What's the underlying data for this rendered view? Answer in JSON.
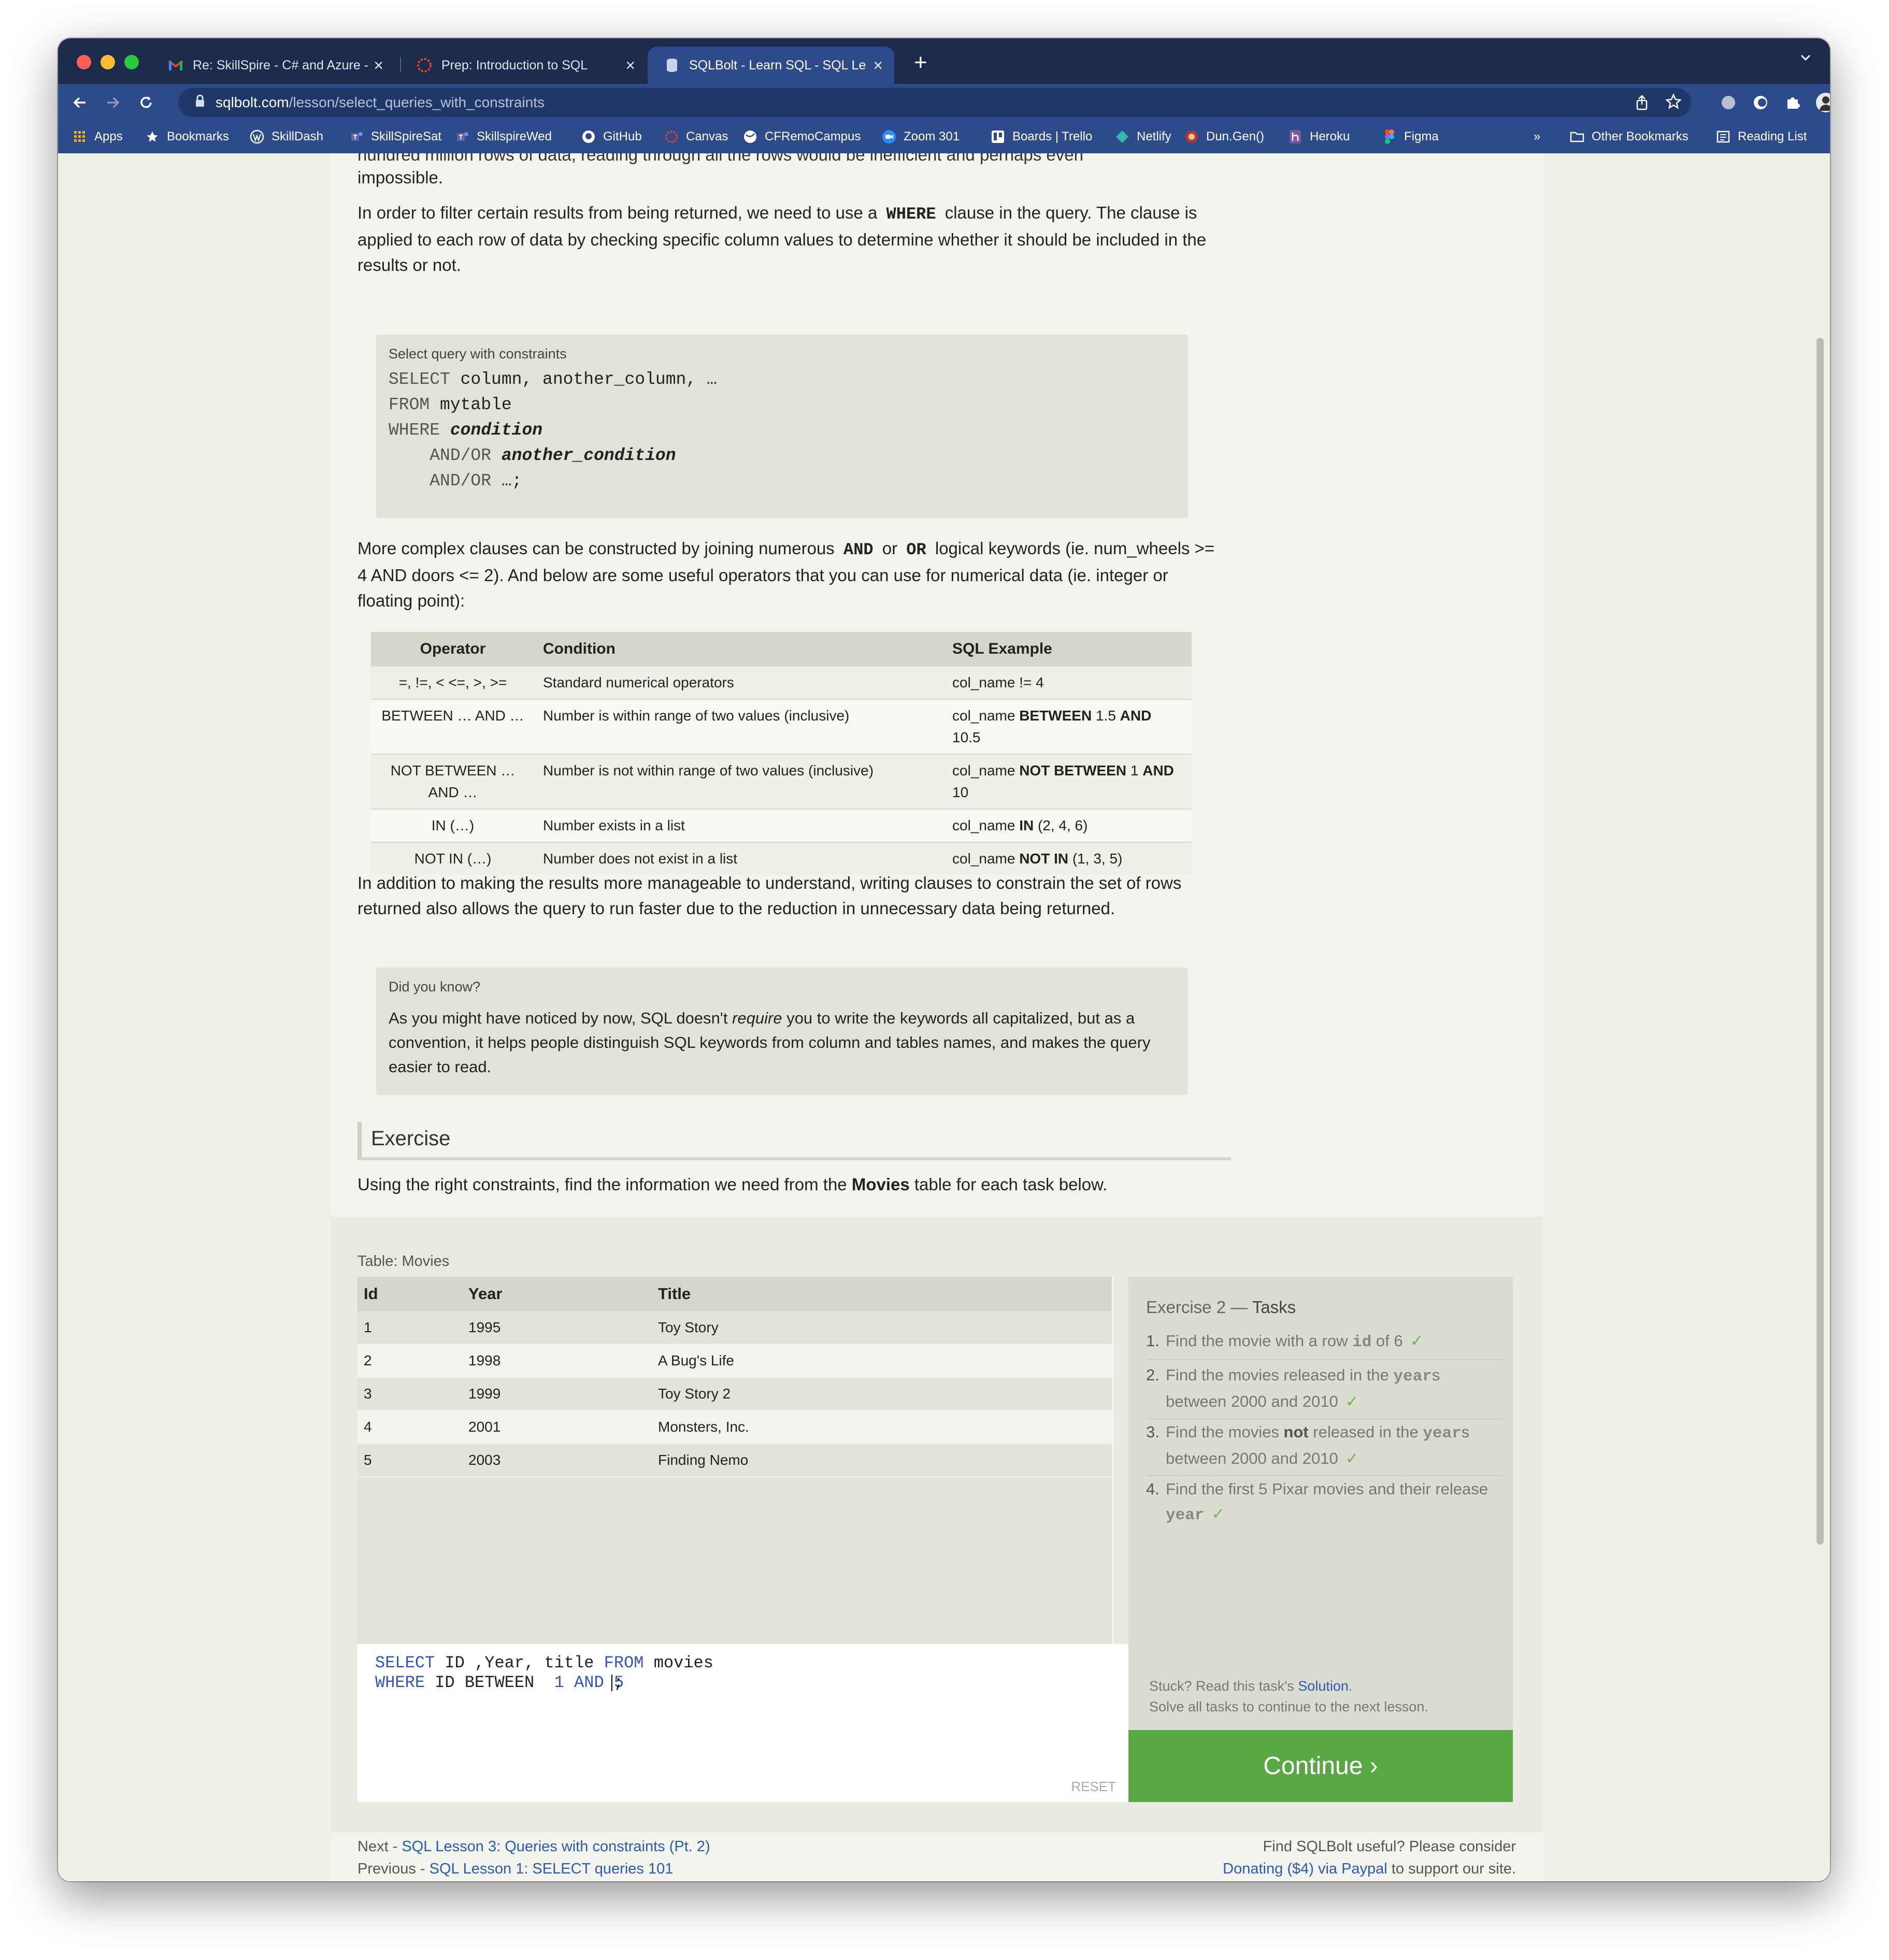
{
  "browser": {
    "tabs": [
      {
        "label": "Re: SkillSpire - C# and Azure -",
        "icon": "gmail-icon",
        "active": false
      },
      {
        "label": "Prep: Introduction to SQL",
        "icon": "canvas-icon",
        "active": false
      },
      {
        "label": "SQLBolt - Learn SQL - SQL Les",
        "icon": "sqlbolt-icon",
        "active": true
      }
    ],
    "new_tab_glyph": "+",
    "address": {
      "host": "sqlbolt.com",
      "path": "/lesson/select_queries_with_constraints"
    },
    "bookmarks": [
      {
        "label": "Apps",
        "icon": "apps-grid-icon"
      },
      {
        "label": "Bookmarks",
        "icon": "star-icon"
      },
      {
        "label": "SkillDash",
        "icon": "wordpress-icon"
      },
      {
        "label": "SkillSpireSat",
        "icon": "teams-icon"
      },
      {
        "label": "SkillspireWed",
        "icon": "teams-icon"
      },
      {
        "label": "GitHub",
        "icon": "github-icon"
      },
      {
        "label": "Canvas",
        "icon": "canvas-icon"
      },
      {
        "label": "CFRemoCampus",
        "icon": "globe-icon"
      },
      {
        "label": "Zoom 301",
        "icon": "zoom-icon"
      },
      {
        "label": "Boards | Trello",
        "icon": "trello-icon"
      },
      {
        "label": "Netlify",
        "icon": "netlify-icon"
      },
      {
        "label": "Dun.Gen()",
        "icon": "dungen-icon"
      },
      {
        "label": "Heroku",
        "icon": "heroku-icon"
      },
      {
        "label": "Figma",
        "icon": "figma-icon"
      }
    ],
    "more_glyph": "»",
    "other_bookmarks": "Other Bookmarks",
    "reading_list": "Reading List"
  },
  "lesson": {
    "cut_top_text": "hundred million rows of data, reading through all the rows would be inefficient and perhaps even",
    "impossible": "impossible.",
    "p1": [
      "In order to filter certain results from being returned, we need to use a",
      "WHERE",
      "clause in the query. The clause is applied to each row of data by checking specific column values to determine whether it should be included in the results or not."
    ],
    "code_caption": "Select query with constraints",
    "code_lines": [
      {
        "parts": [
          [
            "k",
            "SELECT"
          ],
          [
            "n",
            " column, another_column, …"
          ]
        ]
      },
      {
        "parts": [
          [
            "k",
            "FROM"
          ],
          [
            "n",
            " mytable"
          ]
        ]
      },
      {
        "parts": [
          [
            "k",
            "WHERE"
          ],
          [
            "n",
            " "
          ],
          [
            "b",
            "condition"
          ]
        ]
      },
      {
        "parts": [
          [
            "n",
            "    "
          ],
          [
            "k",
            "AND/OR"
          ],
          [
            "n",
            " "
          ],
          [
            "b",
            "another_condition"
          ]
        ]
      },
      {
        "parts": [
          [
            "n",
            "    "
          ],
          [
            "k",
            "AND/OR"
          ],
          [
            "n",
            " …;"
          ]
        ]
      }
    ],
    "p2": [
      "More complex clauses can be constructed by joining numerous",
      "AND",
      "or",
      "OR",
      "logical keywords (ie. num_wheels >= 4 AND doors <= 2). And below are some useful operators that you can use for numerical data (ie. integer or floating point):"
    ],
    "operators": {
      "headers": [
        "Operator",
        "Condition",
        "SQL Example"
      ],
      "rows": [
        {
          "op": "=, !=, < <=, >, >=",
          "cond": "Standard numerical operators",
          "ex": [
            [
              "n",
              "col_name != 4"
            ]
          ]
        },
        {
          "op": "BETWEEN … AND …",
          "cond": "Number is within range of two values (inclusive)",
          "ex": [
            [
              "n",
              "col_name "
            ],
            [
              "b",
              "BETWEEN"
            ],
            [
              "n",
              " 1.5 "
            ],
            [
              "b",
              "AND"
            ],
            [
              "n",
              " 10.5"
            ]
          ]
        },
        {
          "op": "NOT BETWEEN … AND …",
          "cond": "Number is not within range of two values (inclusive)",
          "ex": [
            [
              "n",
              "col_name "
            ],
            [
              "b",
              "NOT BETWEEN"
            ],
            [
              "n",
              " 1 "
            ],
            [
              "b",
              "AND"
            ],
            [
              "n",
              " 10"
            ]
          ]
        },
        {
          "op": "IN (…)",
          "cond": "Number exists in a list",
          "ex": [
            [
              "n",
              "col_name "
            ],
            [
              "b",
              "IN"
            ],
            [
              "n",
              " (2, 4, 6)"
            ]
          ]
        },
        {
          "op": "NOT IN (…)",
          "cond": "Number does not exist in a list",
          "ex": [
            [
              "n",
              "col_name "
            ],
            [
              "b",
              "NOT IN"
            ],
            [
              "n",
              " (1, 3, 5)"
            ]
          ]
        }
      ]
    },
    "p3": "In addition to making the results more manageable to understand, writing clauses to constrain the set of rows returned also allows the query to run faster due to the reduction in unnecessary data being returned.",
    "dyk_caption": "Did you know?",
    "dyk": [
      "As you might have noticed by now, SQL doesn't",
      "require",
      "you to write the keywords all capitalized, but as a convention, it helps people distinguish SQL keywords from column and tables names, and makes the query easier to read."
    ],
    "exercise_heading": "Exercise",
    "exercise_text": [
      "Using the right constraints, find the information we need from the",
      "Movies",
      "table for each task below."
    ]
  },
  "exercise": {
    "table_label": "Table: Movies",
    "columns": [
      "Id",
      "Year",
      "Title"
    ],
    "rows": [
      [
        "1",
        "1995",
        "Toy Story"
      ],
      [
        "2",
        "1998",
        "A Bug's Life"
      ],
      [
        "3",
        "1999",
        "Toy Story 2"
      ],
      [
        "4",
        "2001",
        "Monsters, Inc."
      ],
      [
        "5",
        "2003",
        "Finding Nemo"
      ]
    ],
    "query_lines": [
      [
        [
          "k",
          "SELECT"
        ],
        [
          "n",
          " ID ,Year, title "
        ],
        [
          "k",
          "FROM"
        ],
        [
          "n",
          " movies"
        ]
      ],
      [
        [
          "k",
          "WHERE"
        ],
        [
          "n",
          " ID BETWEEN  "
        ],
        [
          "k",
          "1"
        ],
        [
          "n",
          " "
        ],
        [
          "k",
          "AND"
        ],
        [
          "n",
          " "
        ],
        [
          "k",
          "5"
        ],
        [
          "n",
          ";"
        ]
      ]
    ],
    "reset_label": "RESET",
    "tasks_heading": "Exercise 2",
    "tasks_heading_sep": " — ",
    "tasks_heading_b": "Tasks",
    "tasks": [
      [
        [
          "n",
          "Find the movie with a row "
        ],
        [
          "c",
          "id"
        ],
        [
          "n",
          " of 6"
        ]
      ],
      [
        [
          "n",
          "Find the movies released in the "
        ],
        [
          "c",
          "year"
        ],
        [
          "n",
          "s between 2000 and 2010"
        ]
      ],
      [
        [
          "n",
          "Find the movies "
        ],
        [
          "s",
          "not"
        ],
        [
          "n",
          " released in the "
        ],
        [
          "c",
          "year"
        ],
        [
          "n",
          "s between 2000 and 2010"
        ]
      ],
      [
        [
          "n",
          "Find the first 5 Pixar movies and their release "
        ],
        [
          "c",
          "year"
        ]
      ]
    ],
    "check_glyph": "✓",
    "stuck_prefix": "Stuck? Read this task's ",
    "solution_link": "Solution",
    "stuck_suffix": ".",
    "solve_all": "Solve all tasks to continue to the next lesson.",
    "continue_label": "Continue ›"
  },
  "footer": {
    "next_prefix": "Next - ",
    "next_link": "SQL Lesson 3: Queries with constraints (Pt. 2)",
    "prev_prefix": "Previous - ",
    "prev_link": "SQL Lesson 1: SELECT queries 101",
    "useful": "Find SQLBolt useful? Please consider",
    "donate_link": "Donating ($4) via Paypal",
    "donate_suffix": " to support our site."
  },
  "colors": {
    "continue_green": "#5aa746",
    "chrome_blue": "#2d4a8a",
    "link_blue": "#2a5bb0",
    "check_green": "#6fb55a"
  }
}
